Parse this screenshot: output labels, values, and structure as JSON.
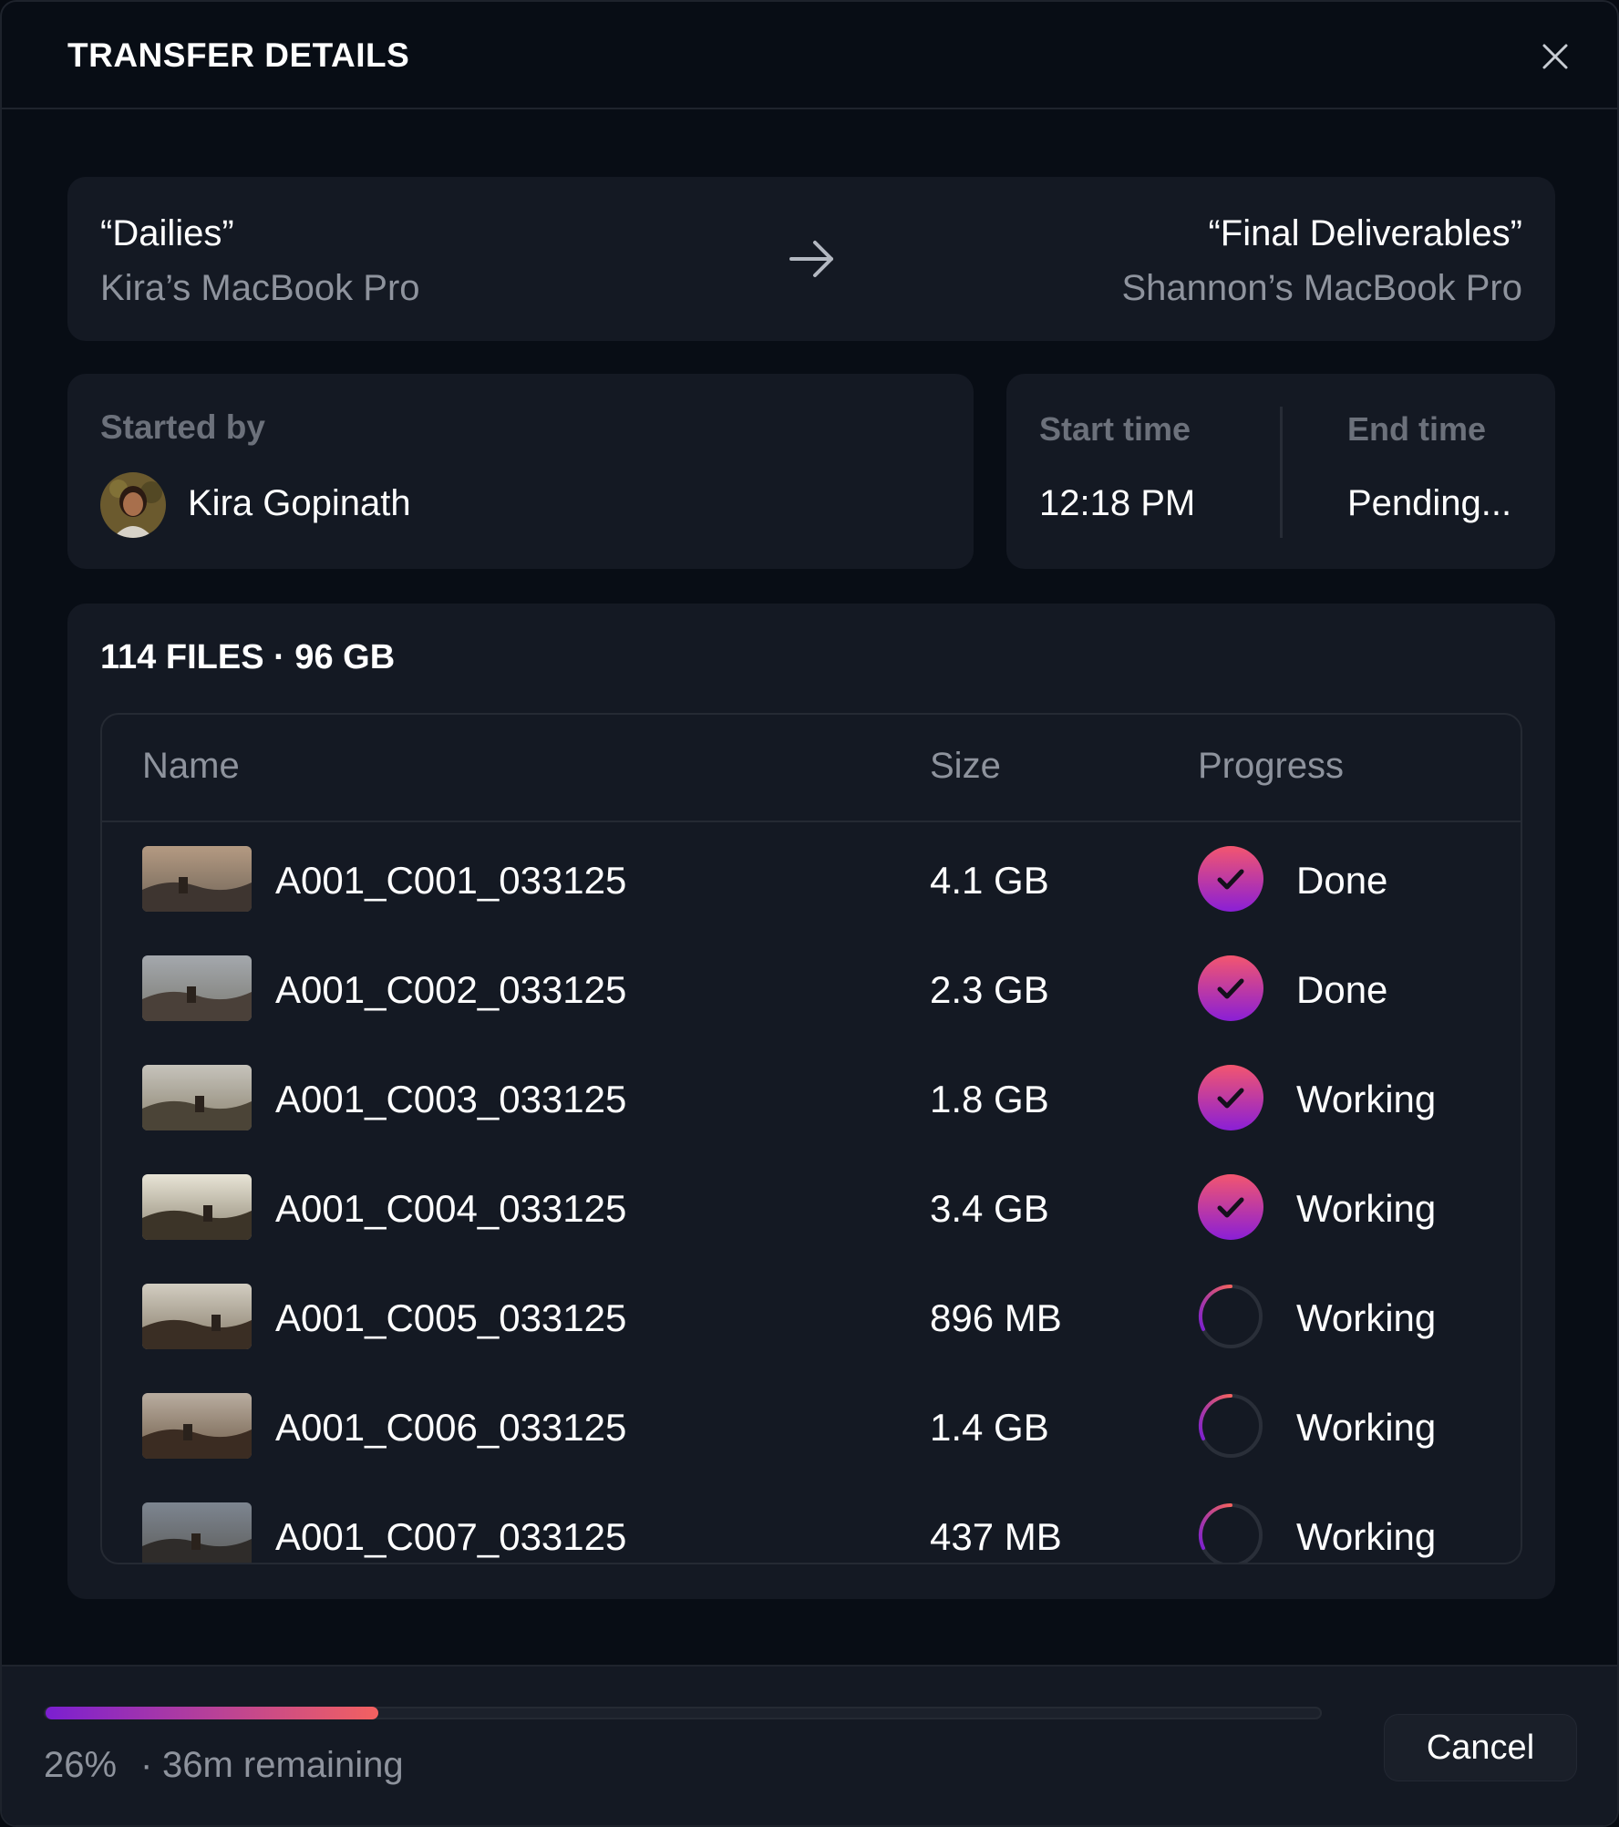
{
  "header": {
    "title": "TRANSFER DETAILS",
    "close_icon": "close-icon"
  },
  "route": {
    "source_name": "“Dailies”",
    "source_device": "Kira’s MacBook Pro",
    "destination_name": "“Final Deliverables”",
    "destination_device": "Shannon’s MacBook Pro",
    "arrow_icon": "arrow-right-icon"
  },
  "started_by": {
    "label": "Started by",
    "name": "Kira Gopinath",
    "avatar_icon": "avatar"
  },
  "times": {
    "start_label": "Start time",
    "start_value": "12:18 PM",
    "end_label": "End time",
    "end_value": "Pending..."
  },
  "files": {
    "summary": "114 FILES · 96 GB",
    "columns": {
      "name": "Name",
      "size": "Size",
      "progress": "Progress"
    },
    "rows": [
      {
        "name": "A001_C001_033125",
        "size": "4.1 GB",
        "status": "Done",
        "complete": true
      },
      {
        "name": "A001_C002_033125",
        "size": "2.3 GB",
        "status": "Done",
        "complete": true
      },
      {
        "name": "A001_C003_033125",
        "size": "1.8 GB",
        "status": "Working",
        "complete": true
      },
      {
        "name": "A001_C004_033125",
        "size": "3.4 GB",
        "status": "Working",
        "complete": true
      },
      {
        "name": "A001_C005_033125",
        "size": "896 MB",
        "status": "Working",
        "complete": false
      },
      {
        "name": "A001_C006_033125",
        "size": "1.4 GB",
        "status": "Working",
        "complete": false
      },
      {
        "name": "A001_C007_033125",
        "size": "437 MB",
        "status": "Working",
        "complete": false
      }
    ]
  },
  "footer": {
    "percent_label": "26%",
    "progress_fraction": 0.26,
    "separator": "·",
    "remaining": "36m remaining",
    "cancel_label": "Cancel"
  },
  "colors": {
    "background": "#080d15",
    "card": "#141923",
    "muted_text": "#8e939d",
    "accent_start": "#7b1fd1",
    "accent_end": "#f36160"
  }
}
